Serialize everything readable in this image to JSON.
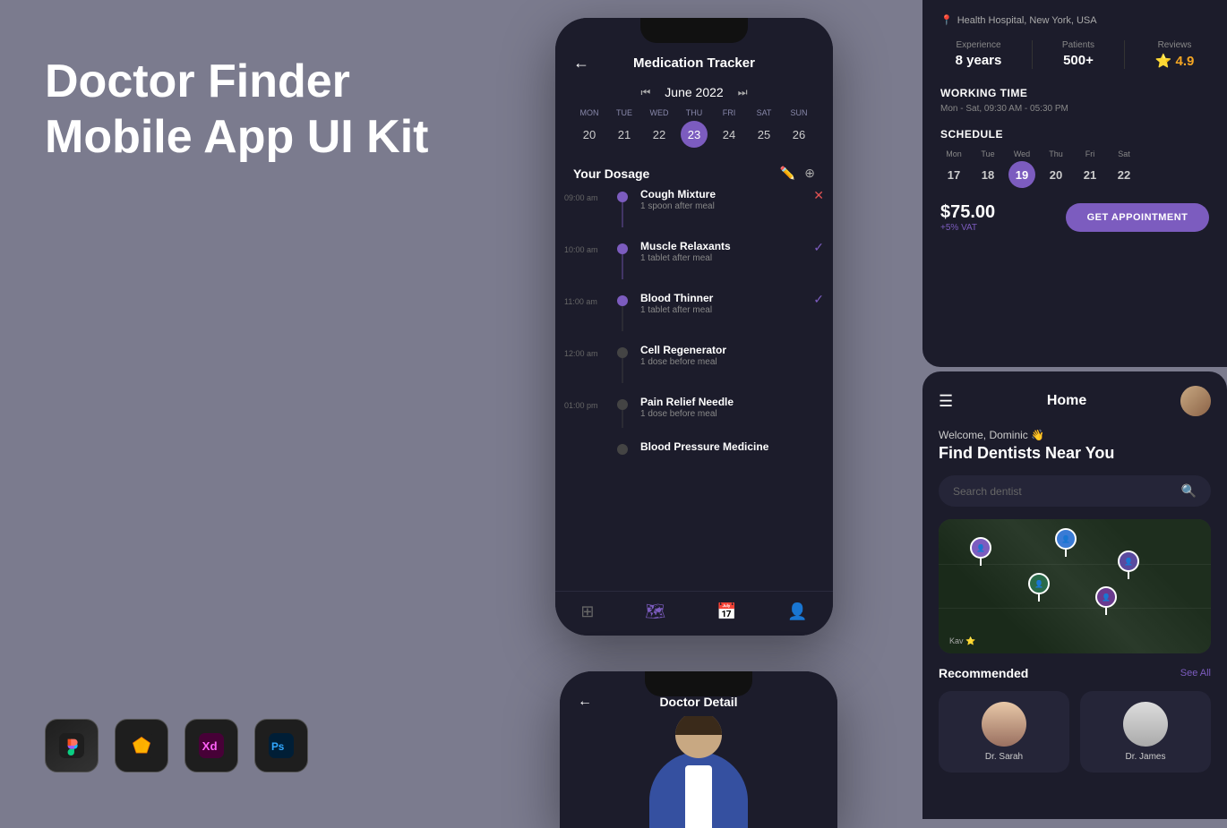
{
  "hero": {
    "title_line1": "Doctor Finder",
    "title_line2": "Mobile App UI Kit"
  },
  "tools": [
    {
      "name": "Figma",
      "color": "#1e1e1e",
      "symbol": "❑"
    },
    {
      "name": "Sketch",
      "color": "#1e1e1e",
      "symbol": "◇"
    },
    {
      "name": "XD",
      "color": "#1e1e1e",
      "symbol": "✕"
    },
    {
      "name": "Photoshop",
      "color": "#1e1e1e",
      "symbol": "Ps"
    }
  ],
  "medication_tracker": {
    "title": "Medication Tracker",
    "month": "June 2022",
    "week": [
      {
        "day": "Mon",
        "num": "20",
        "active": false
      },
      {
        "day": "Tue",
        "num": "21",
        "active": false
      },
      {
        "day": "Wed",
        "num": "22",
        "active": false
      },
      {
        "day": "Thu",
        "num": "23",
        "active": true
      },
      {
        "day": "Fri",
        "num": "24",
        "active": false
      },
      {
        "day": "Sat",
        "num": "25",
        "active": false
      },
      {
        "day": "Sun",
        "num": "26",
        "active": false
      }
    ],
    "dosage_section_title": "Your Dosage",
    "medications": [
      {
        "time": "09:00 am",
        "name": "Cough Mixture",
        "dose": "1 spoon after meal",
        "active": true,
        "status": "remove"
      },
      {
        "time": "10:00 am",
        "name": "Muscle Relaxants",
        "dose": "1 tablet after meal",
        "active": true,
        "status": "done"
      },
      {
        "time": "11:00 am",
        "name": "Blood Thinner",
        "dose": "1 tablet after meal",
        "active": true,
        "status": "done"
      },
      {
        "time": "12:00 am",
        "name": "Cell Regenerator",
        "dose": "1 dose before meal",
        "active": false,
        "status": ""
      },
      {
        "time": "01:00 pm",
        "name": "Pain Relief Needle",
        "dose": "1 dose before meal",
        "active": false,
        "status": ""
      },
      {
        "time": "",
        "name": "Blood Pressure Medicine",
        "dose": "",
        "active": false,
        "status": ""
      }
    ]
  },
  "doctor_detail": {
    "title": "Doctor Detail"
  },
  "doctor_profile": {
    "location": "Health Hospital, New York, USA",
    "experience_label": "Experience",
    "experience_value": "8 years",
    "patients_label": "Patients",
    "patients_value": "500+",
    "reviews_label": "Reviews",
    "reviews_value": "4.9",
    "working_time_title": "WORKING TIME",
    "working_hours": "Mon - Sat, 09:30 AM - 05:30 PM",
    "schedule_title": "SCHEDULE",
    "schedule_days": [
      {
        "name": "Mon",
        "num": "17",
        "active": false
      },
      {
        "name": "Tue",
        "num": "18",
        "active": false
      },
      {
        "name": "Wed",
        "num": "19",
        "active": true
      },
      {
        "name": "Thu",
        "num": "20",
        "active": false
      },
      {
        "name": "Fri",
        "num": "21",
        "active": false
      },
      {
        "name": "Sat",
        "num": "22",
        "active": false
      }
    ],
    "price": "$75.00",
    "price_vat": "+5% VAT",
    "appointment_btn": "GET APPOINTMENT"
  },
  "home_screen": {
    "title": "Home",
    "welcome": "Welcome, Dominic 👋",
    "find_title": "Find Dentists Near You",
    "search_placeholder": "Search dentist",
    "recommended_title": "Recommended",
    "see_all": "See All"
  }
}
